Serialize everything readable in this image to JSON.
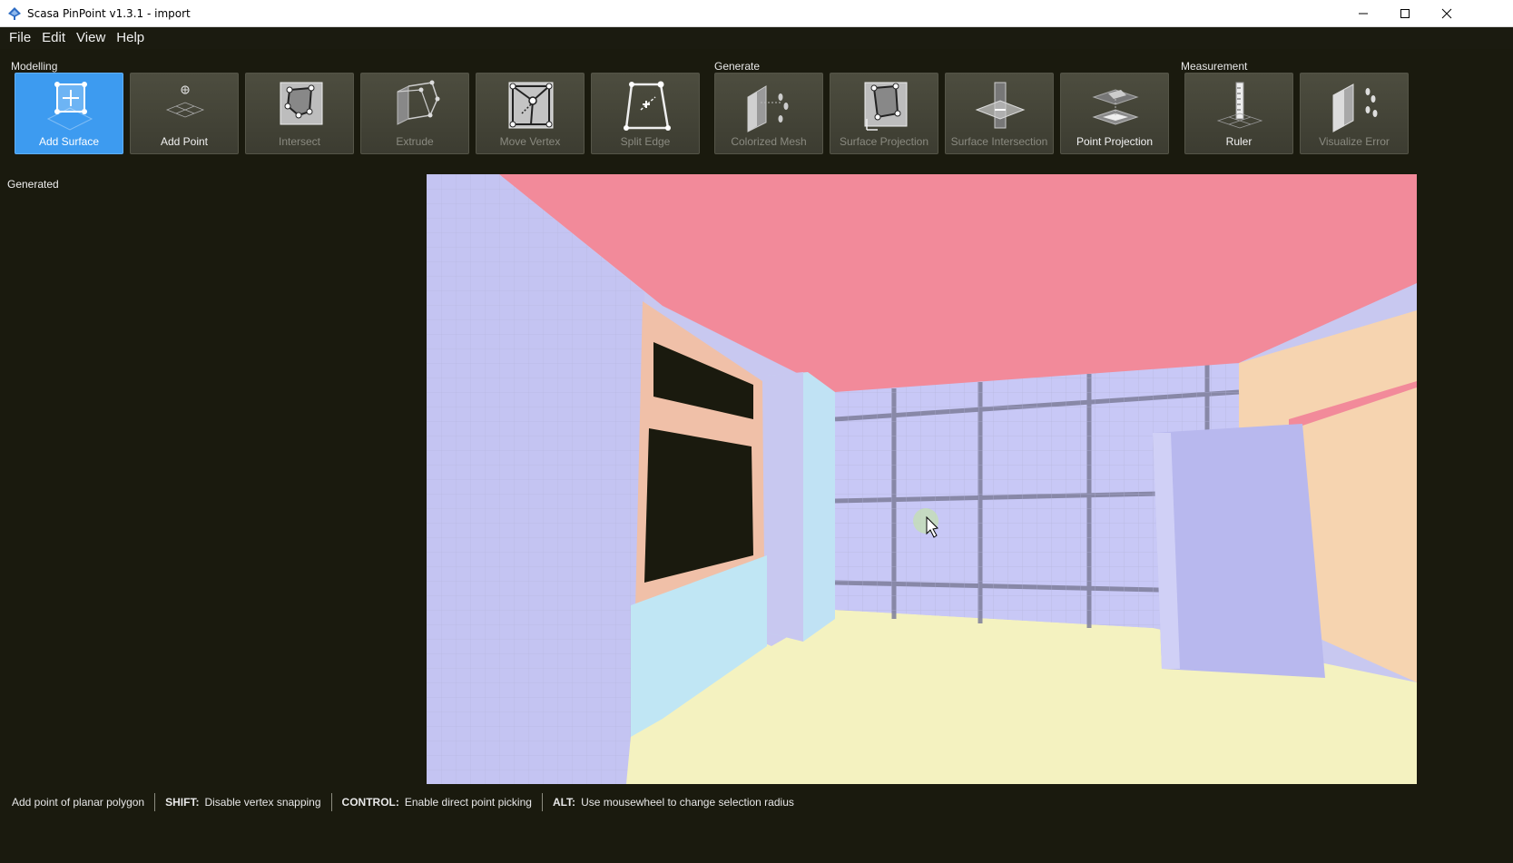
{
  "window": {
    "title": "Scasa PinPoint v1.3.1 - import"
  },
  "menu": [
    "File",
    "Edit",
    "View",
    "Help"
  ],
  "toolbar": {
    "groups": {
      "modelling": "Modelling",
      "generate": "Generate",
      "measurement": "Measurement"
    },
    "tools": [
      {
        "label": "Add Surface",
        "icon": "add-surface-icon",
        "state": "active"
      },
      {
        "label": "Add Point",
        "icon": "add-point-icon",
        "state": "enabled"
      },
      {
        "label": "Intersect",
        "icon": "intersect-icon",
        "state": "disabled"
      },
      {
        "label": "Extrude",
        "icon": "extrude-icon",
        "state": "disabled"
      },
      {
        "label": "Move Vertex",
        "icon": "move-vertex-icon",
        "state": "disabled"
      },
      {
        "label": "Split Edge",
        "icon": "split-edge-icon",
        "state": "disabled"
      },
      {
        "label": "Colorized Mesh",
        "icon": "colorized-mesh-icon",
        "state": "disabled"
      },
      {
        "label": "Surface Projection",
        "icon": "surface-projection-icon",
        "state": "disabled"
      },
      {
        "label": "Surface Intersection",
        "icon": "surface-intersection-icon",
        "state": "disabled"
      },
      {
        "label": "Point Projection",
        "icon": "point-projection-icon",
        "state": "enabled"
      },
      {
        "label": "Ruler",
        "icon": "ruler-icon",
        "state": "enabled"
      },
      {
        "label": "Visualize Error",
        "icon": "visualize-error-icon",
        "state": "disabled"
      }
    ]
  },
  "left_panel": {
    "title": "Generated"
  },
  "viewport": {
    "colors": {
      "ceiling": "#f28a9a",
      "left_wall": "#c4c4f2",
      "back_wall": "#c8c8f6",
      "right_wall": "#f6d4b0",
      "floor": "#f4f2c0",
      "window_frame": "#f0c0a8",
      "window_glass": "#1a1a0e",
      "grid_line": "#7d7d9a"
    }
  },
  "status": {
    "hint": "Add point of planar polygon",
    "items": [
      {
        "key": "SHIFT:",
        "text": "Disable vertex snapping"
      },
      {
        "key": "CONTROL:",
        "text": "Enable direct point picking"
      },
      {
        "key": "ALT:",
        "text": "Use mousewheel to change selection radius"
      }
    ]
  }
}
